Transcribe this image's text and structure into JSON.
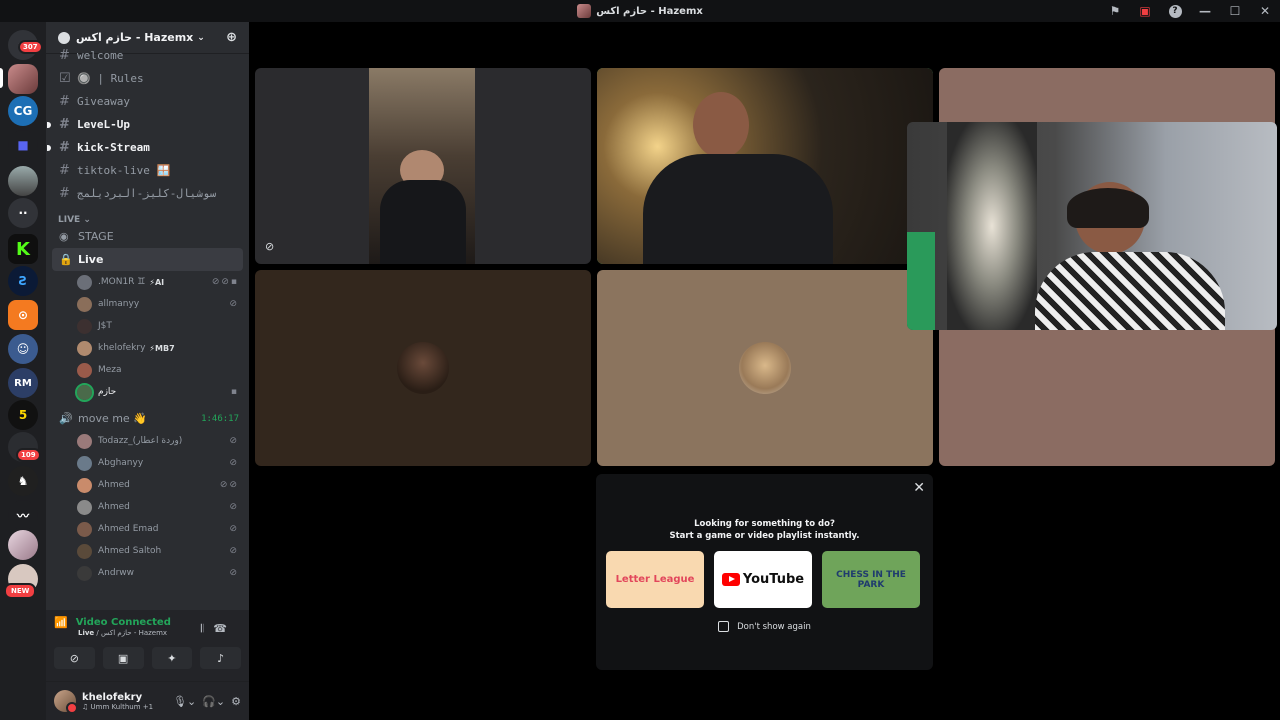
{
  "window": {
    "title": "حازم اكس - Hazemx"
  },
  "server_rail": {
    "home_badge": "307",
    "badge_109": "109",
    "new_label": "NEW"
  },
  "guild": {
    "name": "حازم اكس - Hazemx"
  },
  "channels": [
    {
      "name": "welcome",
      "bold": false
    },
    {
      "name": "🔘 | Rules",
      "bold": false
    },
    {
      "name": "Giveaway",
      "bold": false
    },
    {
      "name": "LeveL-Up",
      "bold": true
    },
    {
      "name": "kick-Stream",
      "bold": true
    },
    {
      "name": "tiktok-live 🪟",
      "bold": false
    },
    {
      "name": "سوشيال-كليز-البرديلمج",
      "bold": false
    }
  ],
  "category_live": "LIVE ⌄",
  "voice": {
    "stage": "STAGE",
    "live": "Live",
    "live_users": [
      {
        "name": ".MON1R ♊",
        "tag": "⚡AI"
      },
      {
        "name": "allmanyy",
        "tag": ""
      },
      {
        "name": "J$T",
        "tag": ""
      },
      {
        "name": "khelofekry",
        "tag": "⚡MB7"
      },
      {
        "name": "Meza",
        "tag": ""
      },
      {
        "name": "حازم",
        "tag": ""
      }
    ],
    "move_me": "move me 👋",
    "move_me_timer": "1:46:17",
    "move_users": [
      {
        "name": "Todazz_(وردة اعطار)"
      },
      {
        "name": "Abghanyy"
      },
      {
        "name": "Ahmed"
      },
      {
        "name": "Ahmed"
      },
      {
        "name": "Ahmed Emad"
      },
      {
        "name": "Ahmed Saltoh"
      },
      {
        "name": "Andrww"
      }
    ]
  },
  "connection": {
    "status": "Video Connected",
    "channel": "Live",
    "server": "حازم اكس - Hazemx"
  },
  "user": {
    "name": "khelofekry",
    "status": "♫ Umm Kulthum +1"
  },
  "activity_invite": {
    "line1": "Looking for something to do?",
    "line2": "Start a game or video playlist instantly.",
    "card1": "Letter League",
    "card2": "YouTube",
    "card3": "CHESS IN THE PARK",
    "checkbox_label": "Don't show again"
  },
  "colors": {
    "speaking_outline": "#23a55a",
    "connected_green": "#23a55a",
    "badge_red": "#f23f42"
  }
}
